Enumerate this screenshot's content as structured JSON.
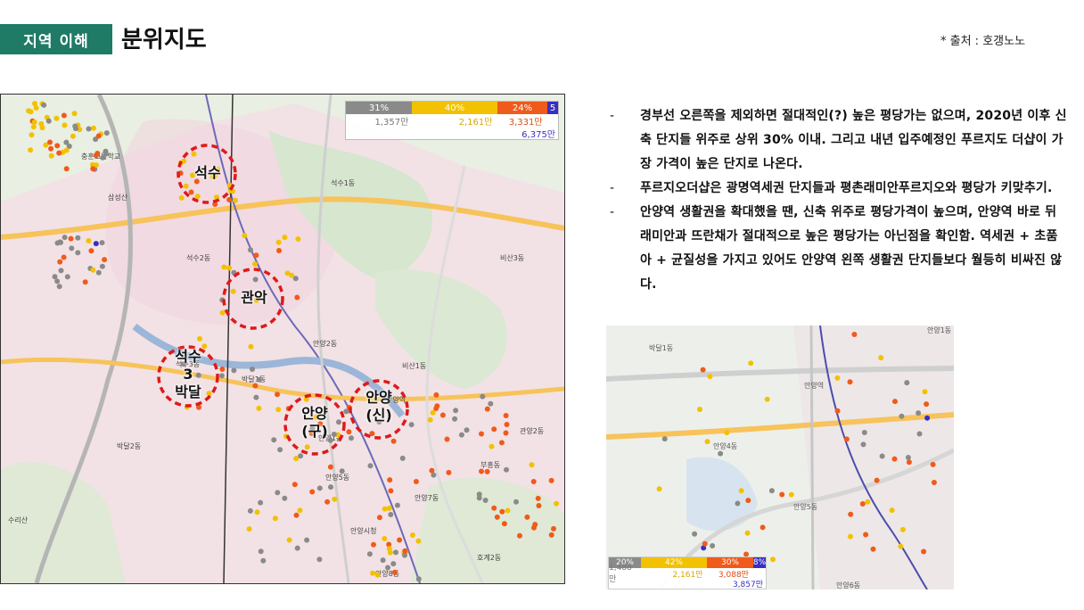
{
  "header": {
    "tag_label": "지역 이해",
    "title": "분위지도",
    "source": "* 출처 : 호갱노노"
  },
  "colors": {
    "tag_bg": "#1f7a66",
    "gray": "#8a8a8a",
    "yellow": "#f2c100",
    "orange": "#f05a1a",
    "purple": "#3a2fc0",
    "circle": "#dd1a1a"
  },
  "main_map": {
    "legend": {
      "segments": [
        "31%",
        "40%",
        "24%",
        "5"
      ],
      "values": [
        "1,357만",
        "2,161만",
        "3,331만",
        "6,375만"
      ]
    },
    "regions": [
      {
        "label": "석수"
      },
      {
        "label": "관악"
      },
      {
        "label": "석수\n3\n박달"
      },
      {
        "label": "안양\n(구)"
      },
      {
        "label": "안양\n(신)"
      }
    ],
    "place_labels": [
      "석수1동",
      "석수2동",
      "석수3동",
      "안양2동",
      "안양5동",
      "안양7동",
      "박달1동",
      "박달2동",
      "비산3동",
      "비산1동",
      "부흥동",
      "호계2동",
      "안양1동",
      "안양8동",
      "관양2동",
      "충훈고등학교",
      "삼성산",
      "안양역",
      "안양시청",
      "수리산"
    ]
  },
  "bullets": [
    {
      "text": "경부선 오른쪽을 제외하면 절대적인(?) 높은 평당가는 없으며, 2020년 이후 신축 단지들 위주로 상위 30% 이내. 그리고 내년 입주예정인 푸르지도 더샵이 가장 가격이 높은 단지로 나온다."
    },
    {
      "text": "푸르지오더샵은 광명역세권 단지들과 평촌래미안푸르지오와 평당가 키맞추기."
    },
    {
      "text": "안양역 생활권을 확대했을 땐, 신축 위주로 평당가격이 높으며, 안양역 바로 뒤 래미안과 뜨란채가 절대적으로 높은 평당가는 아닌점을 확인함. 역세권 + 초품아 + 균질성을 가지고 있어도 안양역 왼쪽 생활권 단지들보다 월등히 비싸진 않다."
    }
  ],
  "small_map": {
    "legend": {
      "segments": [
        "20%",
        "42%",
        "30%",
        "8%"
      ],
      "values": [
        "1,488만",
        "2,161만",
        "3,088만",
        "3,857만"
      ]
    },
    "place_labels": [
      "박달1동",
      "안양4동",
      "안양5동",
      "안양역",
      "안양6동",
      "안양1동"
    ]
  }
}
